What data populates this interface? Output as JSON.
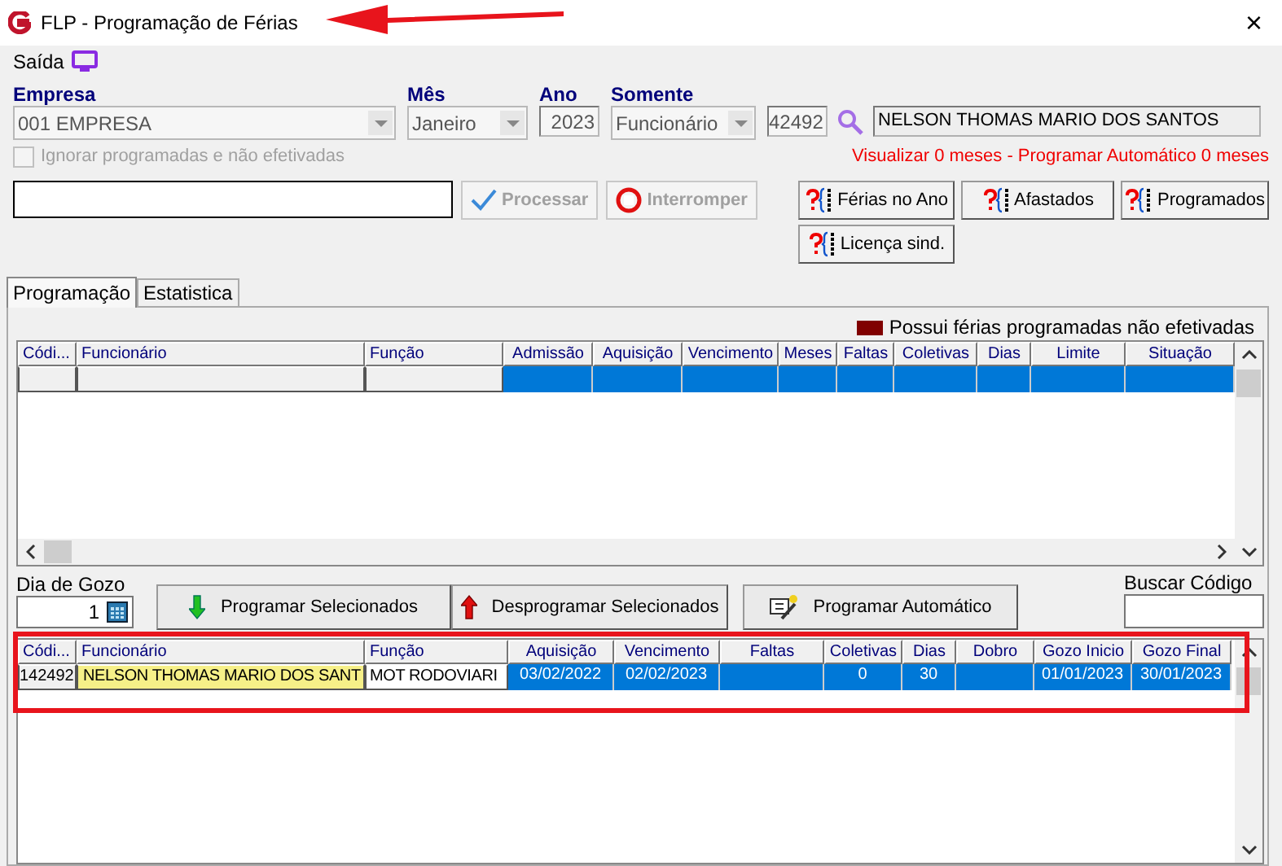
{
  "window": {
    "title": "FLP - Programação de Férias",
    "close": "×"
  },
  "menu": [
    {
      "label": "Saída"
    }
  ],
  "filters": [
    {
      "label": "Empresa",
      "value": "001 EMPRESA",
      "kind": "combo"
    },
    {
      "label": "Mês",
      "value": "Janeiro",
      "kind": "combo"
    },
    {
      "label": "Ano",
      "value": "2023",
      "kind": "number"
    },
    {
      "label": "Somente",
      "value": "Funcionário",
      "kind": "combo"
    }
  ],
  "employee_code": "42492",
  "employee_name": "NELSON THOMAS MARIO DOS SANTOS",
  "ignore_checkbox": {
    "label": "Ignorar programadas e não efetivadas",
    "checked": false,
    "disabled": true
  },
  "info_text": "Visualizar 0 meses - Programar Automático 0 meses",
  "actions": [
    {
      "label": "Processar",
      "kind": "check",
      "disabled": true
    },
    {
      "label": "Interromper",
      "kind": "stop",
      "disabled": true
    }
  ],
  "query_buttons": [
    {
      "label": "Férias no Ano"
    },
    {
      "label": "Afastados"
    },
    {
      "label": "Programados"
    },
    {
      "label": "Licença sind."
    }
  ],
  "tabs": [
    {
      "label": "Programação",
      "selected": true
    },
    {
      "label": "Estatistica",
      "selected": false
    }
  ],
  "legend": {
    "label": "Possui férias programadas não efetivadas",
    "color": "#800000"
  },
  "grid_top": {
    "columns": [
      {
        "label": "Códi...",
        "kind": "code"
      },
      {
        "label": "Funcionário",
        "kind": "name"
      },
      {
        "label": "Função",
        "kind": "fixed"
      },
      {
        "label": "Admissão",
        "kind": "data"
      },
      {
        "label": "Aquisição",
        "kind": "data"
      },
      {
        "label": "Vencimento",
        "kind": "data"
      },
      {
        "label": "Meses",
        "kind": "data"
      },
      {
        "label": "Faltas",
        "kind": "data"
      },
      {
        "label": "Coletivas",
        "kind": "data"
      },
      {
        "label": "Dias",
        "kind": "data"
      },
      {
        "label": "Limite",
        "kind": "data"
      },
      {
        "label": "Situação",
        "kind": "data"
      }
    ],
    "rows": [
      {
        "selected": true,
        "highlighted": false,
        "cells": [
          null,
          null,
          null,
          null,
          null,
          null,
          null,
          null,
          null,
          null,
          null,
          null
        ]
      }
    ]
  },
  "day_field": {
    "label": "Dia de Gozo",
    "value": "1"
  },
  "program_buttons": [
    {
      "label": "Programar Selecionados",
      "kind": "down"
    },
    {
      "label": "Desprogramar Selecionados",
      "kind": "up"
    },
    {
      "label": "Programar Automático",
      "kind": "auto"
    }
  ],
  "search_code": {
    "label": "Buscar Código"
  },
  "grid_bottom": {
    "columns": [
      {
        "label": "Códi...",
        "kind": "code"
      },
      {
        "label": "Funcionário",
        "kind": "name"
      },
      {
        "label": "Função",
        "kind": "fixed"
      },
      {
        "label": "Aquisição",
        "kind": "data"
      },
      {
        "label": "Vencimento",
        "kind": "data"
      },
      {
        "label": "Faltas",
        "kind": "data"
      },
      {
        "label": "Coletivas",
        "kind": "data"
      },
      {
        "label": "Dias",
        "kind": "data"
      },
      {
        "label": "Dobro",
        "kind": "data"
      },
      {
        "label": "Gozo Inicio",
        "kind": "data"
      },
      {
        "label": "Gozo Final",
        "kind": "data"
      }
    ],
    "rows": [
      {
        "selected": true,
        "highlighted": true,
        "cells": [
          "142492",
          "NELSON THOMAS MARIO DOS SANT",
          "MOT RODOVIARI",
          "03/02/2022",
          "02/02/2023",
          null,
          "0",
          "30",
          null,
          "01/01/2023",
          "30/01/2023"
        ]
      }
    ]
  }
}
